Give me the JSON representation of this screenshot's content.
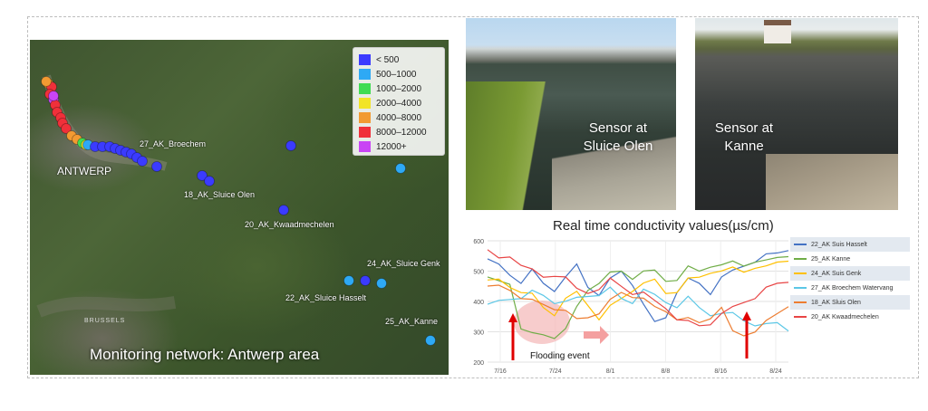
{
  "map": {
    "title": "Monitoring network: Antwerp area",
    "city_label": "ANTWERP",
    "brussels_label": "BRUSSELS",
    "station_labels": [
      "27_AK_Broechem",
      "18_AK_Sluice Olen",
      "20_AK_Kwaadmechelen",
      "24_AK_Sluice Genk",
      "22_AK_Sluice Hasselt",
      "25_AK_Kanne"
    ],
    "legend": [
      {
        "label": "< 500",
        "color": "#3b3bff"
      },
      {
        "label": "500–1000",
        "color": "#2ea9f5"
      },
      {
        "label": "1000–2000",
        "color": "#3fdc52"
      },
      {
        "label": "2000–4000",
        "color": "#f2e426"
      },
      {
        "label": "4000–8000",
        "color": "#f29a32"
      },
      {
        "label": "8000–12000",
        "color": "#f0303a"
      },
      {
        "label": "12000+",
        "color": "#c944f5"
      }
    ]
  },
  "photos": {
    "olen_caption_line1": "Sensor at",
    "olen_caption_line2": "Sluice Olen",
    "kanne_caption_line1": "Sensor at",
    "kanne_caption_line2": "Kanne"
  },
  "chart_data": {
    "type": "line",
    "title": "Real time conductivity values(µs/cm)",
    "x_tick_labels": [
      "7/16",
      "7/24",
      "8/1",
      "8/8",
      "8/16",
      "8/24"
    ],
    "y_ticks": [
      200,
      300,
      400,
      500,
      600
    ],
    "ylim": [
      200,
      600
    ],
    "annotation": "Flooding event",
    "series": [
      {
        "name": "22_AK Suis Hasselt",
        "color": "#4472c4",
        "values": [
          530,
          520,
          490,
          470,
          500,
          460,
          440,
          470,
          520,
          450,
          430,
          470,
          500,
          460,
          380,
          330,
          350,
          440,
          470,
          460,
          430,
          470,
          500,
          520,
          540,
          550,
          560,
          575
        ]
      },
      {
        "name": "25_AK Kanne",
        "color": "#70ad47",
        "values": [
          470,
          465,
          460,
          320,
          290,
          290,
          285,
          300,
          380,
          440,
          470,
          490,
          500,
          480,
          490,
          500,
          470,
          480,
          510,
          500,
          520,
          510,
          530,
          520,
          540,
          530,
          545,
          555
        ]
      },
      {
        "name": "24_AK Suis Genk",
        "color": "#ffc000",
        "values": [
          460,
          470,
          450,
          440,
          420,
          380,
          360,
          400,
          430,
          390,
          350,
          380,
          410,
          440,
          450,
          470,
          430,
          440,
          470,
          480,
          500,
          490,
          510,
          500,
          520,
          510,
          530,
          540
        ]
      },
      {
        "name": "27_AK Broechem Watervang",
        "color": "#5bc7e6",
        "values": [
          380,
          400,
          410,
          420,
          430,
          420,
          400,
          390,
          410,
          420,
          430,
          440,
          410,
          400,
          430,
          420,
          400,
          390,
          410,
          380,
          360,
          350,
          360,
          340,
          330,
          320,
          330,
          310
        ]
      },
      {
        "name": "18_AK Sluis Olen",
        "color": "#ed7d31",
        "values": [
          440,
          450,
          440,
          420,
          400,
          390,
          380,
          360,
          340,
          350,
          370,
          400,
          430,
          420,
          400,
          380,
          370,
          350,
          340,
          330,
          350,
          370,
          300,
          290,
          310,
          330,
          360,
          390
        ]
      },
      {
        "name": "20_AK Kwaadmechelen",
        "color": "#e84545",
        "values": [
          560,
          540,
          550,
          530,
          500,
          480,
          490,
          470,
          440,
          430,
          450,
          470,
          450,
          430,
          420,
          400,
          380,
          350,
          330,
          320,
          330,
          350,
          380,
          400,
          420,
          440,
          460,
          470
        ]
      }
    ]
  }
}
